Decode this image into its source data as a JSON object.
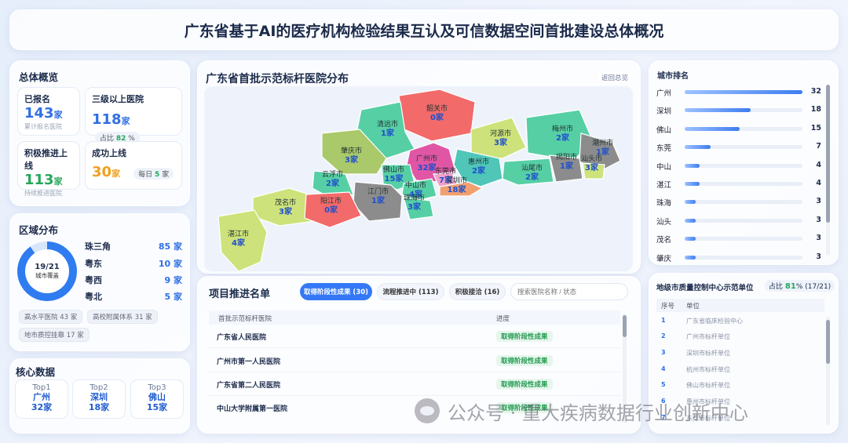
{
  "title": "广东省基于AI的医疗机构检验结果互认及可信数据空间首批建设总体概况",
  "overview": {
    "title": "总体概览",
    "registered": {
      "label": "已报名",
      "value": "143",
      "unit": "家",
      "sub": "累计报名医院"
    },
    "tier3": {
      "label": "三级以上医院",
      "value": "118",
      "unit": "家",
      "ratio_label": "占比",
      "ratio": "82",
      "pct": "%"
    },
    "active": {
      "label": "积极推进上线",
      "value": "113",
      "unit": "家",
      "sub": "持续推进医院"
    },
    "online": {
      "label": "成功上线",
      "value": "30",
      "unit": "家",
      "daily_label": "每日",
      "daily": "5",
      "daily_unit": "家"
    }
  },
  "region": {
    "title": "区域分布",
    "donut_center": "19/21",
    "donut_sub": "城市覆盖",
    "donut_fraction": 0.905,
    "rows": [
      {
        "name": "珠三角",
        "value": "85 家"
      },
      {
        "name": "粤东",
        "value": "10 家"
      },
      {
        "name": "粤西",
        "value": "9 家"
      },
      {
        "name": "粤北",
        "value": "5 家"
      }
    ],
    "tags": [
      "高水平医院 43 家",
      "高校附属体系 31 家",
      "地市质控挂靠 17 家"
    ]
  },
  "core": {
    "title": "核心数据",
    "items": [
      {
        "rank": "Top1",
        "city": "广州",
        "count": "32家"
      },
      {
        "rank": "Top2",
        "city": "深圳",
        "count": "18家"
      },
      {
        "rank": "Top3",
        "city": "佛山",
        "count": "15家"
      }
    ]
  },
  "map": {
    "title": "广东省首批示范标杆医院分布",
    "reset": "返回总览",
    "cities": [
      {
        "name": "韶关市",
        "count": "0家",
        "color": "#f26a6a"
      },
      {
        "name": "清远市",
        "count": "1家",
        "color": "#56cfa5"
      },
      {
        "name": "河源市",
        "count": "3家",
        "color": "#cde27a"
      },
      {
        "name": "梅州市",
        "count": "2家",
        "color": "#56cfa5"
      },
      {
        "name": "潮州市",
        "count": "1家",
        "color": "#8c8c8c"
      },
      {
        "name": "肇庆市",
        "count": "3家",
        "color": "#a9c96a"
      },
      {
        "name": "广州市",
        "count": "32家",
        "color": "#e056a5"
      },
      {
        "name": "惠州市",
        "count": "2家",
        "color": "#4fc6b8"
      },
      {
        "name": "揭阳市",
        "count": "1家",
        "color": "#8c8c8c"
      },
      {
        "name": "汕头市",
        "count": "3家",
        "color": "#cde27a"
      },
      {
        "name": "佛山市",
        "count": "15家",
        "color": "#56cfa5"
      },
      {
        "name": "东莞市",
        "count": "7家",
        "color": "#f2a0c8"
      },
      {
        "name": "汕尾市",
        "count": "2家",
        "color": "#56cfa5"
      },
      {
        "name": "深圳市",
        "count": "18家",
        "color": "#f0a070"
      },
      {
        "name": "云浮市",
        "count": "2家",
        "color": "#56cfa5"
      },
      {
        "name": "中山市",
        "count": "4家",
        "color": "#56cfa5"
      },
      {
        "name": "江门市",
        "count": "1家",
        "color": "#8c8c8c"
      },
      {
        "name": "珠海市",
        "count": "3家",
        "color": "#56cfa5"
      },
      {
        "name": "茂名市",
        "count": "3家",
        "color": "#cde27a"
      },
      {
        "name": "阳江市",
        "count": "0家",
        "color": "#f26a6a"
      },
      {
        "name": "湛江市",
        "count": "4家",
        "color": "#cde27a"
      }
    ]
  },
  "projects": {
    "title": "项目推进名单",
    "tabs": [
      "取得阶段性成果 (30)",
      "流程推进中 (113)",
      "积极接洽 (16)"
    ],
    "search_placeholder": "搜索医院名称 / 状态",
    "headers": [
      "首批示范标杆医院",
      "进度"
    ],
    "rows": [
      {
        "name": "广东省人民医院",
        "status": "取得阶段性成果"
      },
      {
        "name": "广州市第一人民医院",
        "status": "取得阶段性成果"
      },
      {
        "name": "广东省第二人民医院",
        "status": "取得阶段性成果"
      },
      {
        "name": "中山大学附属第一医院",
        "status": "取得阶段性成果"
      }
    ]
  },
  "ranking": {
    "title": "城市排名",
    "max": 32,
    "items": [
      {
        "city": "广州",
        "value": 32
      },
      {
        "city": "深圳",
        "value": 18
      },
      {
        "city": "佛山",
        "value": 15
      },
      {
        "city": "东莞",
        "value": 7
      },
      {
        "city": "中山",
        "value": 4
      },
      {
        "city": "湛江",
        "value": 4
      },
      {
        "city": "珠海",
        "value": 3
      },
      {
        "city": "汕头",
        "value": 3
      },
      {
        "city": "茂名",
        "value": 3
      },
      {
        "city": "肇庆",
        "value": 3
      }
    ]
  },
  "quality": {
    "title": "地级市质量控制中心示范单位",
    "ratio_label": "占比",
    "ratio": "81",
    "ratio_rest": "% (17/21)",
    "headers": [
      "序号",
      "单位"
    ],
    "rows": [
      {
        "idx": "1",
        "unit": "广东省临床检验中心"
      },
      {
        "idx": "2",
        "unit": "广州市标杆单位"
      },
      {
        "idx": "3",
        "unit": "深圳市标杆单位"
      },
      {
        "idx": "4",
        "unit": "杭州市标杆单位"
      },
      {
        "idx": "5",
        "unit": "佛山市标杆单位"
      },
      {
        "idx": "6",
        "unit": "惠州市标杆单位"
      },
      {
        "idx": "7",
        "unit": "东莞市标杆单位"
      }
    ]
  },
  "watermark": "公众号 · 重大疾病数据行业创新中心",
  "colors": {
    "accent": "#2f6fe4",
    "success": "#26a65b",
    "warning": "#f0a01e"
  }
}
